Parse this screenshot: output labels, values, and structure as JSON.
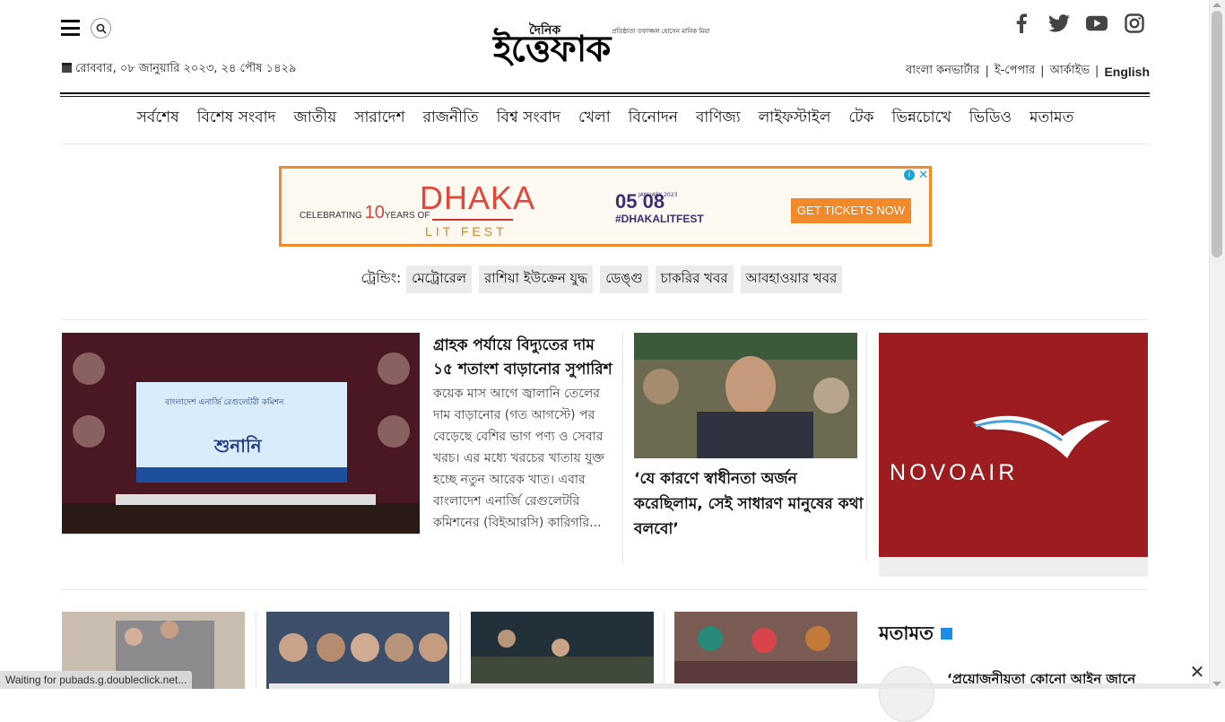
{
  "header": {
    "date": "রোববার, ০৮ জানুয়ারি ২০২৩, ২৪ পৌষ ১৪২৯",
    "logo_small": "দৈনিক",
    "logo_tagline": "প্রতিষ্ঠাতা তফাজ্জল হোসেন মানিক মিয়া",
    "logo_big": "ইত্তেফাক",
    "links": [
      "বাংলা কনভার্টার",
      "ই-পেপার",
      "আর্কাইভ"
    ],
    "english": "English",
    "social": [
      "facebook-icon",
      "twitter-icon",
      "youtube-icon",
      "instagram-icon"
    ]
  },
  "nav": [
    "সর্বশেষ",
    "বিশেষ সংবাদ",
    "জাতীয়",
    "সারাদেশ",
    "রাজনীতি",
    "বিশ্ব সংবাদ",
    "খেলা",
    "বিনোদন",
    "বাণিজ্য",
    "লাইফস্টাইল",
    "টেক",
    "ভিন্নচোখে",
    "ভিডিও",
    "মতামত"
  ],
  "ad": {
    "celebrating": "CELEBRATING",
    "years": "10",
    "years_of": "YEARS OF",
    "dhaka": "DHAKA",
    "lit": "LIT FEST",
    "dates": "05   08",
    "month": "JANUARY 2023",
    "hashtag": "#DHAKALITFEST",
    "cta": "GET TICKETS NOW"
  },
  "trending": {
    "label": "ট্রেন্ডিং:",
    "tags": [
      "মেট্রোরেল",
      "রাশিয়া ইউক্রেন যুদ্ধ",
      "ডেঙ্গু",
      "চাকরির খবর",
      "আবহাওয়ার খবর"
    ]
  },
  "lead": {
    "title": "গ্রাহক পর্যায়ে বিদ্যুতের দাম ১৫ শতাংশ বাড়ানোর সুপারিশ",
    "body": "কয়েক মাস আগে জ্বালানি তেলের দাম বাড়ানোর (গত আগস্টে) পর বেড়েছে বেশির ভাগ পণ্য ও সেবার খরচ। এর মধ্যে খরচের খাতায় যুক্ত হচ্ছে নতুন আরেক খাত। এবার বাংলাদেশ এনার্জি রেগুলেটরি কমিশনের (বিইআরসি) কারিগরি...",
    "banner_title": "বাংলাদেশ এনার্জি রেগুলেটরী কমিশন",
    "banner_hearing": "শুনানি"
  },
  "second": {
    "title": "‘যে কারণে স্বাধীনতা অর্জন করেছিলাম, সেই সাধারণ মানুষের কথা বলবো’"
  },
  "sidebar_ad": {
    "brand": "NOVOAIR"
  },
  "opinion": {
    "heading": "মতামত",
    "first_title": "‘প্রয়োজনীয়তা কোনো আইন জানে"
  },
  "status_text": "Waiting for pubads.g.doubleclick.net...",
  "colors": {
    "ad_border": "#f08a2a",
    "novo_bg": "#9c1c1f",
    "accent_blue": "#1a8ee6"
  }
}
